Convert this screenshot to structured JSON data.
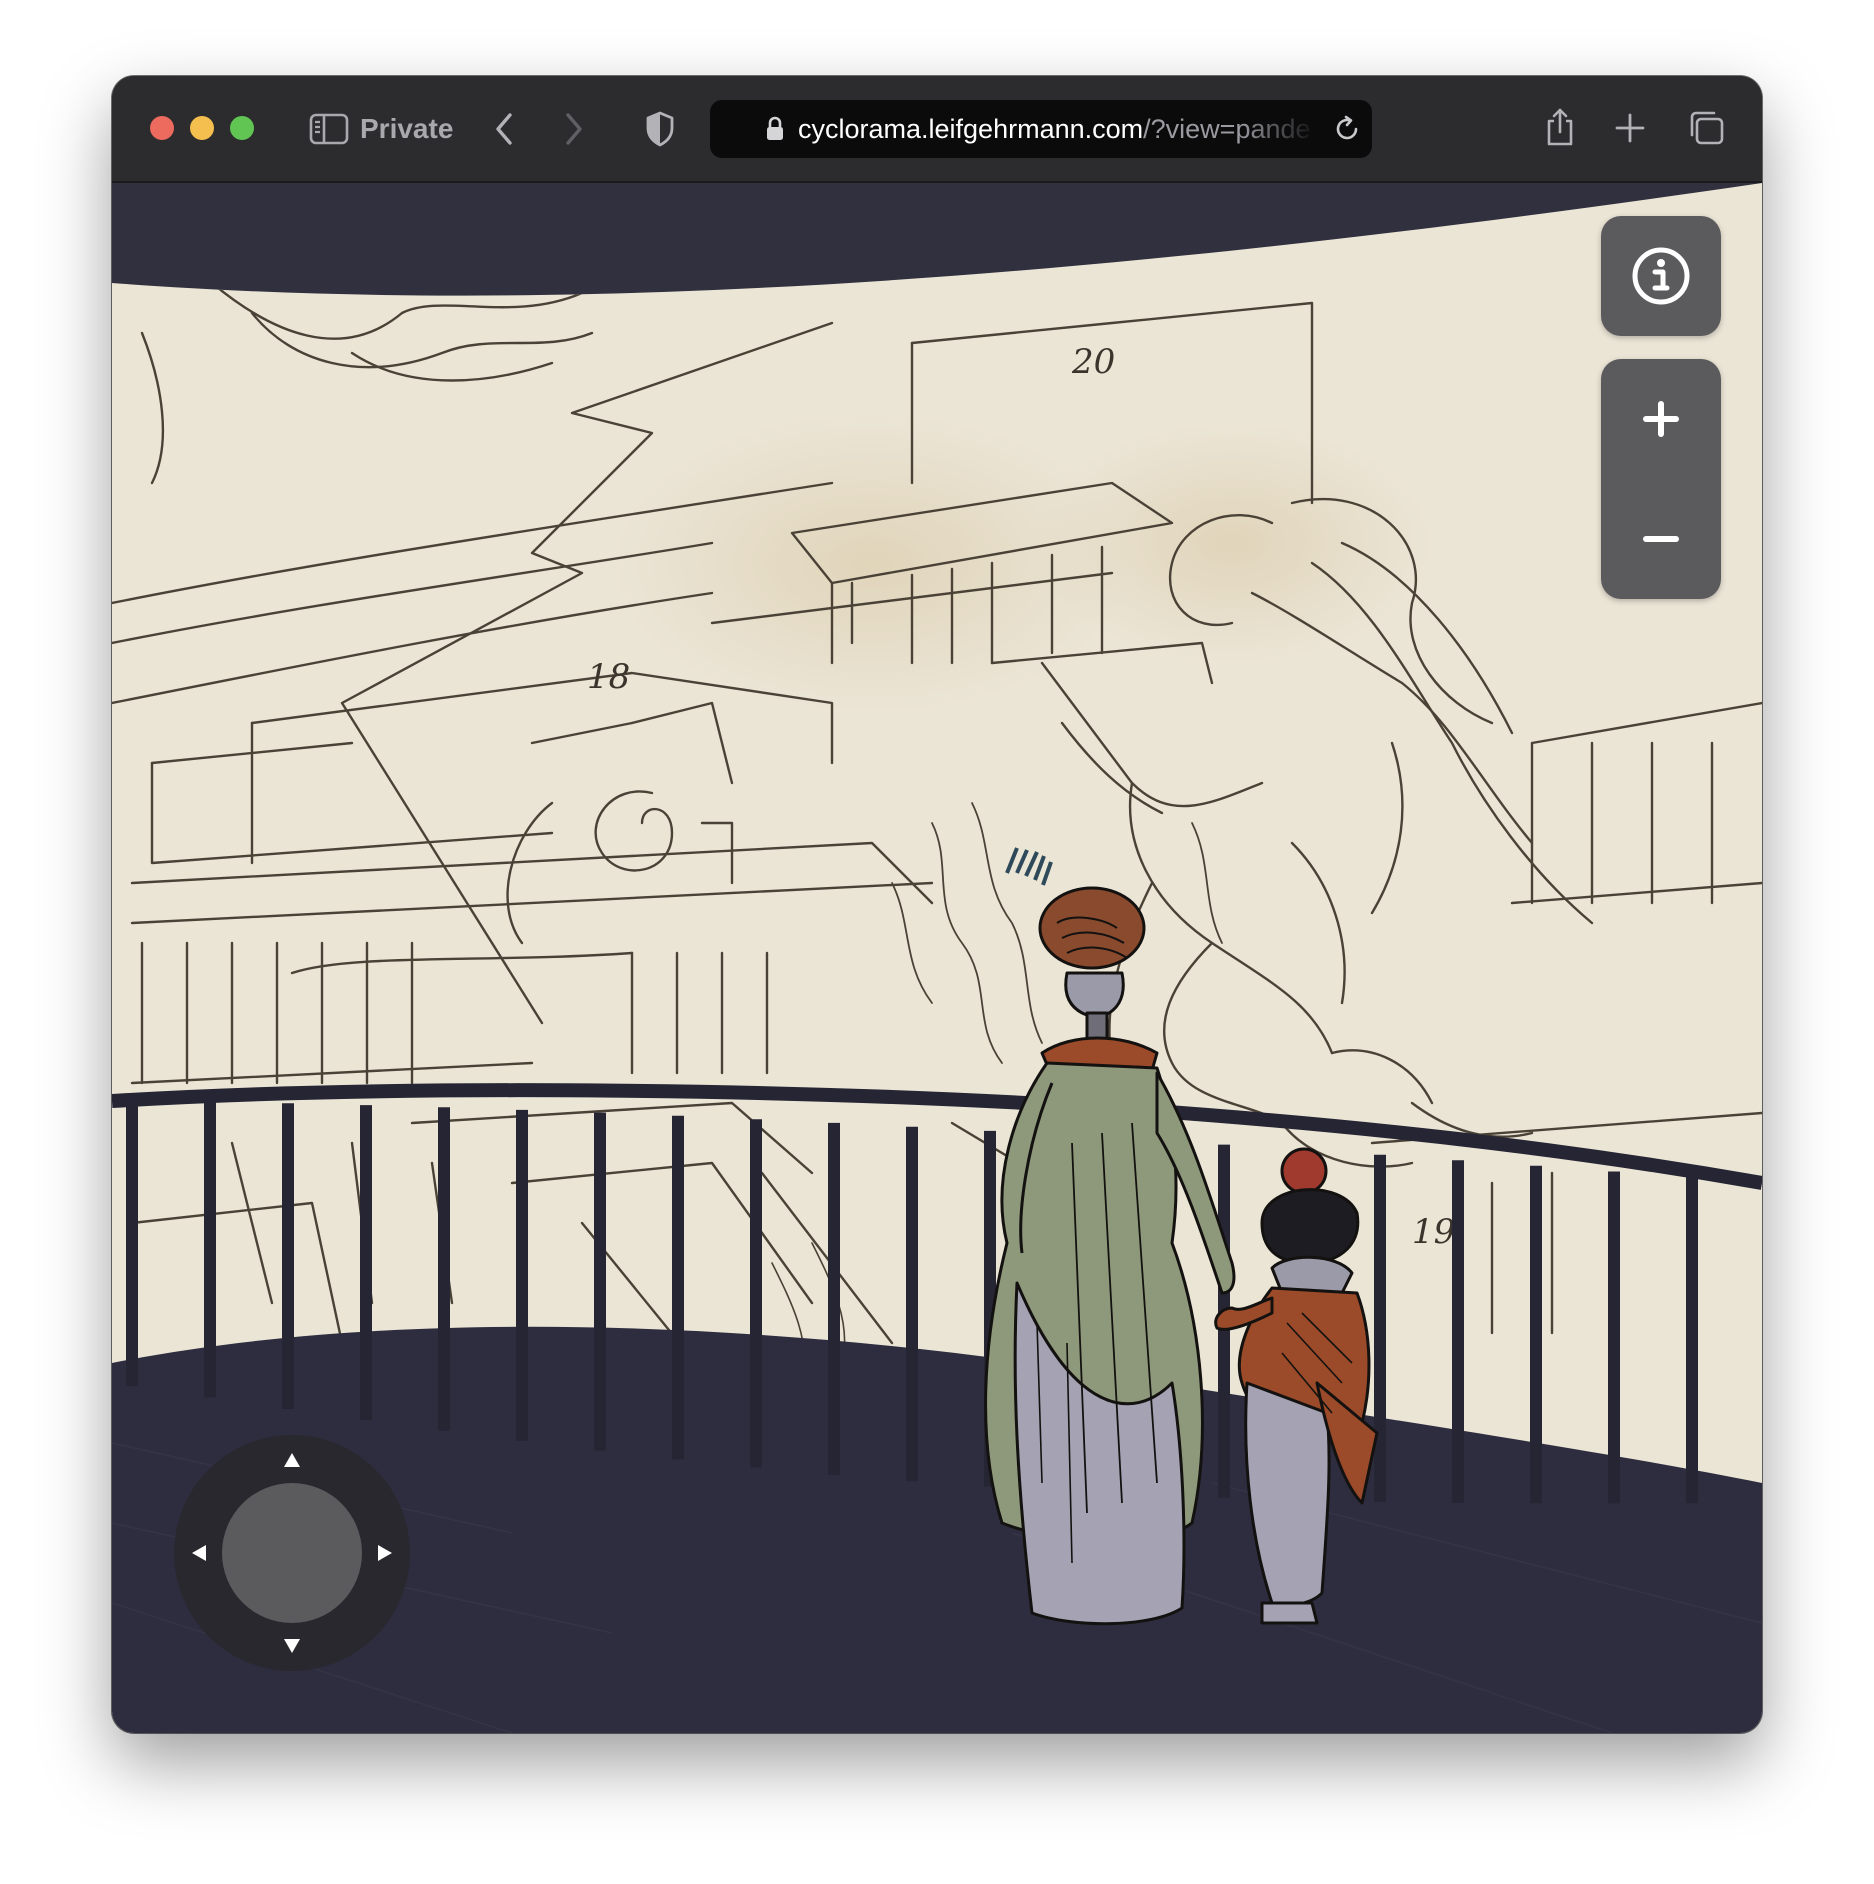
{
  "browser": {
    "mode_label": "Private",
    "url_host": "cyclorama.leifgehrmann.com",
    "url_path": "/?view=pande"
  },
  "panorama": {
    "figure_labels": [
      "20",
      "18",
      "19"
    ]
  },
  "controls": {
    "info_icon": "info-icon",
    "zoom_in_icon": "plus-icon",
    "zoom_out_icon": "minus-icon",
    "joystick_arrows": [
      "arrow-up-icon",
      "arrow-down-icon",
      "arrow-left-icon",
      "arrow-right-icon"
    ]
  },
  "colors": {
    "sky": "#31303f",
    "paper": "#ebe5d6",
    "ink": "#3a342c",
    "railing": "#262534",
    "floor": "#2e2d3f",
    "coat_green": "#8e987a",
    "rust": "#9b4a2a",
    "skirt_grey": "#a4a2b3",
    "button_bg": "#5b5b5e"
  }
}
